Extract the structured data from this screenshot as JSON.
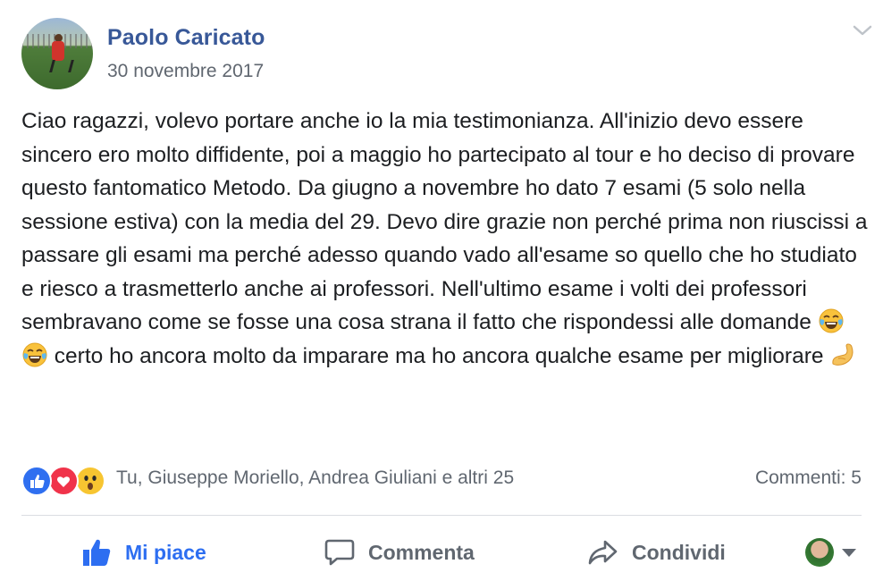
{
  "post": {
    "author": "Paolo Caricato",
    "date": "30 novembre 2017",
    "text_parts": [
      "Ciao ragazzi, volevo portare anche io la mia testimonianza. All'inizio devo essere sincero ero molto diffidente, poi a maggio ho partecipato al tour e ho deciso di provare questo fantomatico Metodo. Da giugno a novembre ho dato 7 esami (5 solo nella sessione estiva) con la media del 29. Devo dire grazie non perché prima non riuscissi a passare gli esami ma perché adesso quando vado all'esame so quello che ho studiato e riesco a trasmetterlo anche ai professori. Nell'ultimo esame i volti dei professori sembravano come se fosse una cosa strana il fatto che rispondessi alle domande ",
      " certo ho ancora molto da imparare ma ho ancora qualche esame per migliorare "
    ],
    "emojis": [
      "tears-of-joy",
      "tears-of-joy",
      "flexed-biceps"
    ]
  },
  "reactions": {
    "icons": [
      "like",
      "love",
      "wow"
    ],
    "names": "Tu, Giuseppe Moriello, Andrea Giuliani e altri 25",
    "comments": "Commenti: 5"
  },
  "actions": {
    "like_label": "Mi piace",
    "comment_label": "Commenta",
    "share_label": "Condividi"
  },
  "colors": {
    "link": "#385898",
    "like_active": "#2d6ef1",
    "muted": "#606770"
  }
}
